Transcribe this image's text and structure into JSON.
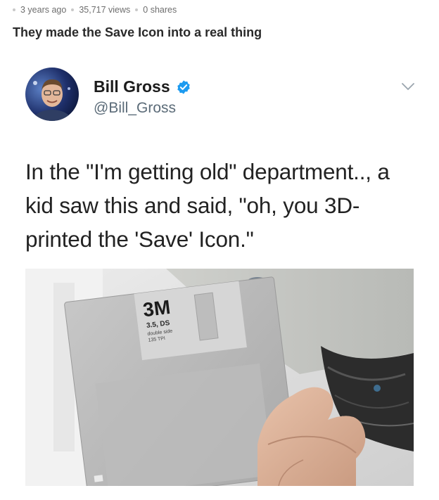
{
  "post": {
    "age": "3 years ago",
    "views": "35,717 views",
    "shares": "0 shares",
    "title": "They made the Save Icon into a real thing"
  },
  "tweet": {
    "display_name": "Bill Gross",
    "handle": "@Bill_Gross",
    "text": "In the \"I'm getting old\" department.., a kid saw this and said, \"oh, you 3D-printed the 'Save' Icon.\""
  },
  "disk_label": {
    "brand": "3M",
    "line1": "3.5, DS",
    "line2": "double side",
    "line3": "135 TPI"
  },
  "colors": {
    "verified": "#1d9bf0",
    "meta_text": "#6e6e6e"
  }
}
